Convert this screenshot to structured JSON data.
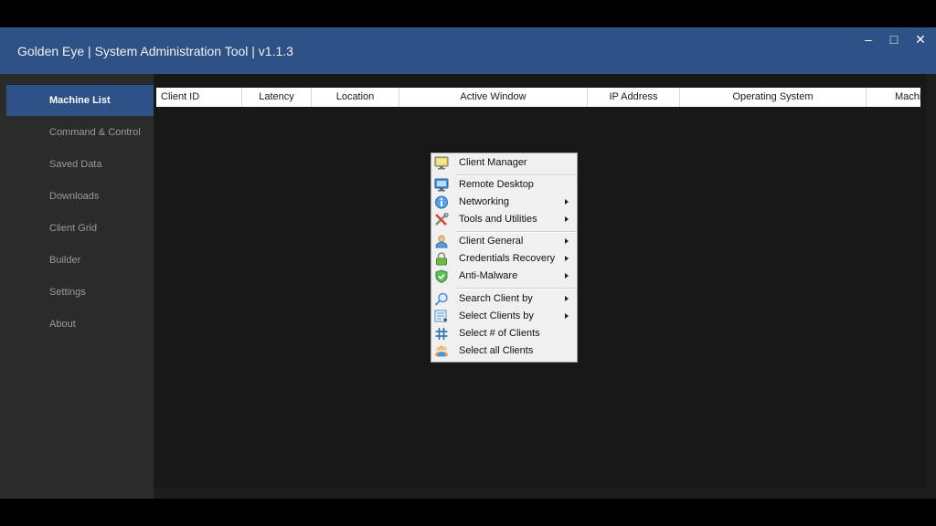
{
  "window": {
    "title": "Golden Eye | System Administration Tool | v1.1.3",
    "controls": {
      "minimize": "–",
      "maximize": "□",
      "close": "✕"
    }
  },
  "sidebar": {
    "items": [
      {
        "label": "Machine List",
        "active": true
      },
      {
        "label": "Command & Control"
      },
      {
        "label": "Saved Data"
      },
      {
        "label": "Downloads"
      },
      {
        "label": "Client Grid"
      },
      {
        "label": "Builder"
      },
      {
        "label": "Settings"
      },
      {
        "label": "About"
      }
    ]
  },
  "table": {
    "columns": [
      "Client ID",
      "Latency",
      "Location",
      "Active Window",
      "IP Address",
      "Operating System",
      "Machi"
    ]
  },
  "context_menu": {
    "items": [
      {
        "label": "Client Manager",
        "icon": "monitor-icon"
      },
      {
        "label": "Remote Desktop",
        "icon": "remote-desktop-icon"
      },
      {
        "label": "Networking",
        "icon": "network-info-icon",
        "submenu": true
      },
      {
        "label": "Tools and Utilities",
        "icon": "tools-icon",
        "submenu": true
      },
      {
        "label": "Client General",
        "icon": "user-icon",
        "submenu": true
      },
      {
        "label": "Credentials Recovery",
        "icon": "lock-icon",
        "submenu": true
      },
      {
        "label": "Anti-Malware",
        "icon": "shield-icon",
        "submenu": true
      },
      {
        "label": "Search Client by",
        "icon": "search-icon",
        "submenu": true
      },
      {
        "label": "Select Clients by",
        "icon": "select-list-icon",
        "submenu": true
      },
      {
        "label": "Select # of Clients",
        "icon": "hash-icon"
      },
      {
        "label": "Select all Clients",
        "icon": "users-group-icon"
      }
    ]
  },
  "colors": {
    "title_bar": "#2e5186",
    "sidebar_active": "#2e5186",
    "sidebar_bg": "#2b2b2b",
    "main_bg": "#181818"
  }
}
